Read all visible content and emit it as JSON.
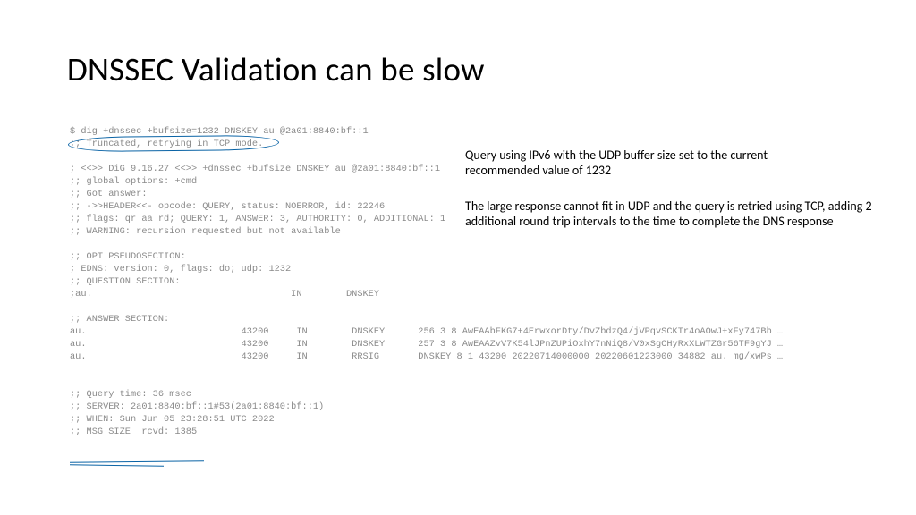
{
  "title": "DNSSEC Validation can be slow",
  "terminal": "$ dig +dnssec +bufsize=1232 DNSKEY au @2a01:8840:bf::1\n;; Truncated, retrying in TCP mode.\n\n; <<>> DiG 9.16.27 <<>> +dnssec +bufsize DNSKEY au @2a01:8840:bf::1\n;; global options: +cmd\n;; Got answer:\n;; ->>HEADER<<- opcode: QUERY, status: NOERROR, id: 22246\n;; flags: qr aa rd; QUERY: 1, ANSWER: 3, AUTHORITY: 0, ADDITIONAL: 1\n;; WARNING: recursion requested but not available\n\n;; OPT PSEUDOSECTION:\n; EDNS: version: 0, flags: do; udp: 1232\n;; QUESTION SECTION:\n;au.                                    IN        DNSKEY\n\n;; ANSWER SECTION:\nau.                            43200     IN        DNSKEY      256 3 8 AwEAAbFKG7+4ErwxorDty/DvZbdzQ4/jVPqvSCKTr4oAOwJ+xFy747Bb …\nau.                            43200     IN        DNSKEY      257 3 8 AwEAAZvV7K54lJPnZUPiOxhY7nNiQ8/V0xSgCHyRxXLWTZGr56TF9gYJ …\nau.                            43200     IN        RRSIG       DNSKEY 8 1 43200 20220714000000 20220601223000 34882 au. mg/xwPs …\n\n\n;; Query time: 36 msec\n;; SERVER: 2a01:8840:bf::1#53(2a01:8840:bf::1)\n;; WHEN: Sun Jun 05 23:28:51 UTC 2022\n;; MSG SIZE  rcvd: 1385",
  "note1": "Query using IPv6 with the UDP buffer size set to the current recommended value of 1232",
  "note2": "The large response cannot fit in UDP and the query is retried using TCP, adding 2 additional round trip intervals to the time to complete the DNS response"
}
